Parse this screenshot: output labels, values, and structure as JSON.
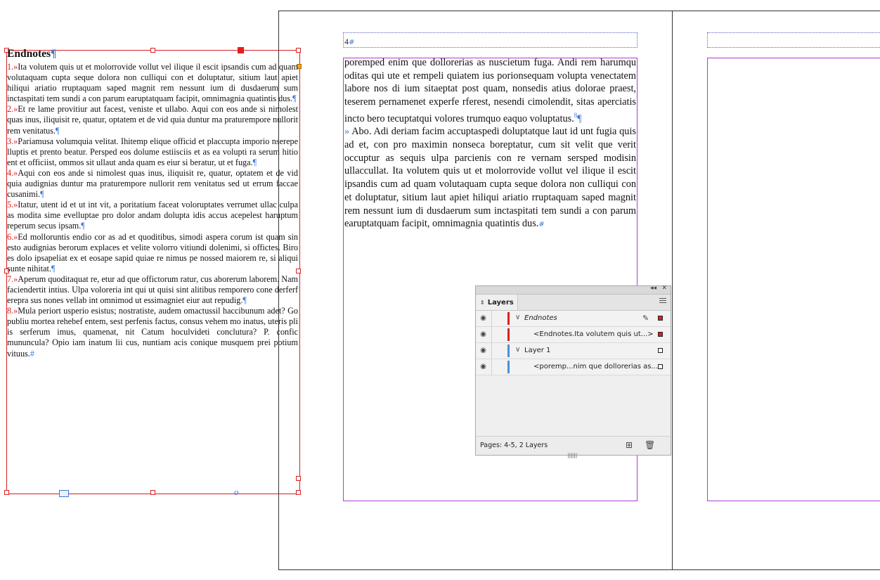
{
  "document": {
    "left_page_number": "4",
    "body_paragraphs": [
      "poremped enim que dollorerias as nuscietum fuga. Andi rem harumqu oditas qui ute et rempeli quiatem ius porionsequam volupta venectatem labore nos di ium sitaeptat post quam, nonsedis atius dolorae praest, teserem pernamenet experfe rferest, nesendi cimolendit, sitas aperciatis incto bero tecuptatqui volores trumquo eaquo voluptatus.",
      "Abo. Adi deriam facim accuptaspedi doluptatque laut id unt fugia quis ad et, con pro maximin nonseca boreptatur, cum sit velit que verit occuptur as sequis ulpa parcienis con re vernam sersped modisin ullaccullat. Ita volutem quis ut et molorrovide vollut vel ilique il escit ipsandis cum ad quam volutaquam cupta seque dolora non culliqui con et doluptatur, sitium laut apiet hiliqui ariatio rruptaquam saped magnit rem nessunt ium di dusdaerum sum inctaspitati tem sundi a con parum earuptatquam facipit, omnimagnia quatintis dus."
    ],
    "endnote_marker": "8",
    "hidden_marker": "»",
    "pilcrow": "¶",
    "end_of_story": "#"
  },
  "endnotes": {
    "title": "Endnotes",
    "entries": [
      {
        "num": "1.",
        "text": "Ita volutem quis ut et molorrovide vollut vel ilique il escit ipsandis cum ad quam volutaquam cupta seque dolora non culliqui con et doluptatur, sitium laut apiet hiliqui ariatio rruptaquam saped magnit rem nessunt ium di dusdaerum sum inctaspitati tem sundi a con parum earuptatquam facipit, omnimagnia quatintis dus."
      },
      {
        "num": "2.",
        "text": "Et re lame provitiur aut facest, veniste et ullabo. Aqui con eos ande si nimolest quas inus, iliquisit re, quatur, optatem et de vid quia duntur ma praturempore nullorit rem venitatus."
      },
      {
        "num": "3.",
        "text": "Pariamusa volumquia velitat. Ihitemp elique officid et placcupta imporio nserepe lluptis et prento beatur. Persped eos dolume estiisciis et as ea volupti ra serum hitio ent et officiist, ommos sit ullaut anda quam es eiur si beratur, ut et fuga."
      },
      {
        "num": "4.",
        "text": "Aqui con eos ande si nimolest quas inus, iliquisit re, quatur, optatem et de vid quia audignias duntur ma praturempore nullorit rem venitatus sed ut errum faccae cusanimi."
      },
      {
        "num": "5.",
        "text": "Itatur, utent id et ut int vit, a poritatium faceat voloruptates verrumet ullac culpa as modita sime evelluptae pro dolor andam dolupta idis accus acepelest haruptum reperum secus ipsam."
      },
      {
        "num": "6.",
        "text": "Ed molloruntis endio cor as ad et quoditibus, simodi aspera corum ist quam sin esto audignias berorum explaces et velite volorro vitiundi dolenimi, si offictes. Biro es dolo ipsapeliat ex et eosape sapid quiae re nimus pe nossed maiorem re, si aliqui sunte nihitat."
      },
      {
        "num": "7.",
        "text": "Aperum quoditaquat re, etur ad que offictorum ratur, cus aborerum laborem. Nam faciendertit intius. Ulpa voloreria int qui ut quisi sint alitibus remporero cone derferf erepra sus nones vellab int omnimod ut essimagniet eiur aut repudig."
      },
      {
        "num": "8.",
        "text": "Mula periort usperio esistus; nostratiste, audem omactussil haccibunum adet? Go publiu mortea rehebef entem, sest perfenis factus, consus vehem mo inatus, uteris pli is serferum imus, quamenat, nit Catum hoculvideti conclutura? P. confic mununcula? Opio iam inatum lii cus, nuntiam acis conique musquem prei potium vituus."
      }
    ],
    "overset_glyph": "o"
  },
  "layers_panel": {
    "tab_label": "Layers",
    "layers": [
      {
        "name": "Endnotes",
        "color": "#e01e1e",
        "expanded": true,
        "level": 0,
        "italic": true,
        "pen": true
      },
      {
        "name": "<Endnotes.Ita volutem quis ut...>",
        "color": "#e01e1e",
        "level": 1,
        "selected": true
      },
      {
        "name": "Layer 1",
        "color": "#4a8fe0",
        "expanded": true,
        "level": 0
      },
      {
        "name": "<poremp...nim que dollorerias as...>",
        "color": "#4a8fe0",
        "level": 1
      }
    ],
    "footer_text": "Pages: 4-5, 2 Layers",
    "icons": {
      "eye": "eye-icon",
      "collapse": "double-chevron-left-icon",
      "close": "close-icon",
      "menu": "hamburger-menu-icon",
      "new_layer": "add-layer-icon",
      "delete": "trash-icon",
      "pen": "pen-icon"
    }
  }
}
